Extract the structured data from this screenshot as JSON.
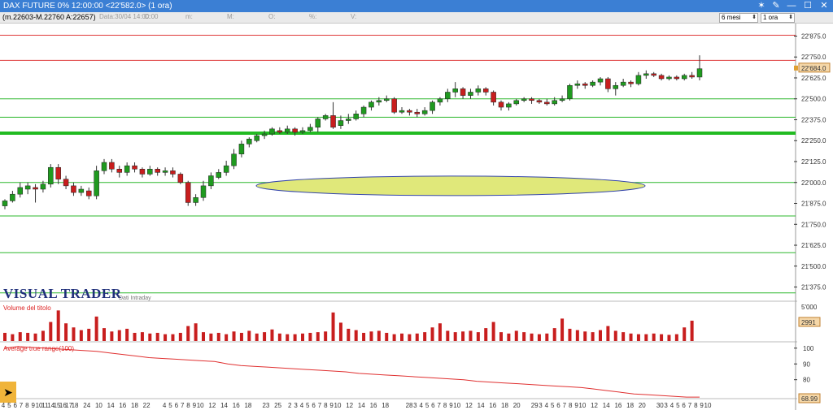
{
  "window": {
    "title": "DAX FUTURE 0%  12:00:00   <22'582.0>  (1 ora)",
    "controls": [
      "✶",
      "✎",
      "—",
      "☐",
      "✕"
    ]
  },
  "infobar": {
    "ohlc": "(m.22603-M.22760 A:22657)",
    "date_label": "Data:30/04 14:00:00",
    "dropdowns": [
      "C:",
      "m:",
      "M:",
      "O:",
      "%:",
      "V:"
    ],
    "period_select": "6 mesi",
    "interval_select": "1 ora"
  },
  "branding": {
    "logo": "VISUAL TRADER",
    "sub": "Dati Intraday"
  },
  "panels": {
    "volume_title": "Volume del titolo",
    "atr_title": "Average true range(100)"
  },
  "price_axis": {
    "ticks": [
      "22'875.0",
      "22'750.0",
      "22'625.0",
      "22'500.0",
      "22'375.0",
      "22'250.0",
      "22'125.0",
      "22'000.0",
      "21'875.0",
      "21'750.0",
      "21'625.0",
      "21'500.0",
      "21'375.0"
    ],
    "current": "22'684.0"
  },
  "volume_axis": {
    "tick": "5'000",
    "current": "2991"
  },
  "atr_axis": {
    "ticks": [
      "100",
      "90",
      "80"
    ],
    "current": "68.99"
  },
  "time_axis": {
    "labels": [
      "4",
      "5",
      "6",
      "7",
      "8",
      "9",
      "10",
      "11",
      "14",
      "15",
      "16",
      "17",
      "18",
      "",
      "24",
      "",
      "10",
      "",
      "14",
      "",
      "16",
      "",
      "18",
      "",
      "22",
      "",
      "",
      "4",
      "5",
      "6",
      "7",
      "8",
      "9",
      "10",
      "",
      "12",
      "",
      "14",
      "",
      "16",
      "",
      "18",
      "",
      "",
      "23",
      "",
      "25",
      "",
      "2",
      "3",
      "4",
      "5",
      "6",
      "7",
      "8",
      "9",
      "10",
      "",
      "12",
      "",
      "14",
      "",
      "16",
      "",
      "18",
      "",
      "",
      "",
      "28",
      "3",
      "4",
      "5",
      "6",
      "7",
      "8",
      "9",
      "10",
      "",
      "12",
      "",
      "14",
      "",
      "16",
      "",
      "18",
      "",
      "20",
      "",
      "",
      "29",
      "3",
      "4",
      "5",
      "6",
      "7",
      "8",
      "9",
      "10",
      "",
      "12",
      "",
      "14",
      "",
      "16",
      "",
      "18",
      "",
      "20",
      "",
      "",
      "30",
      "3",
      "4",
      "5",
      "6",
      "7",
      "8",
      "9",
      "10"
    ],
    "highlight": [
      "24",
      "25",
      "28",
      "29",
      "30"
    ]
  },
  "chart_data": {
    "type": "candlestick",
    "y_range": [
      21300,
      22950
    ],
    "horizontal_lines": {
      "red": [
        22880,
        22730
      ],
      "green": [
        22500,
        22390,
        22300,
        22000,
        21800,
        21580,
        21340
      ],
      "bold_green": 22295
    },
    "candles": [
      [
        21860,
        21890,
        21840,
        21900
      ],
      [
        21890,
        21930,
        21880,
        21950
      ],
      [
        21930,
        21970,
        21910,
        22000
      ],
      [
        21960,
        21980,
        21930,
        22000
      ],
      [
        21970,
        21960,
        21880,
        21990
      ],
      [
        21960,
        21990,
        21940,
        22010
      ],
      [
        21990,
        22090,
        21970,
        22110
      ],
      [
        22090,
        22020,
        21990,
        22110
      ],
      [
        22020,
        21980,
        21960,
        22040
      ],
      [
        21980,
        21940,
        21920,
        22000
      ],
      [
        21940,
        21960,
        21920,
        21980
      ],
      [
        21950,
        21920,
        21900,
        21970
      ],
      [
        21920,
        22070,
        21900,
        22100
      ],
      [
        22070,
        22120,
        22050,
        22140
      ],
      [
        22120,
        22080,
        22060,
        22140
      ],
      [
        22080,
        22060,
        22030,
        22100
      ],
      [
        22060,
        22100,
        22040,
        22120
      ],
      [
        22100,
        22080,
        22060,
        22120
      ],
      [
        22080,
        22050,
        22030,
        22090
      ],
      [
        22050,
        22080,
        22040,
        22100
      ],
      [
        22080,
        22060,
        22040,
        22090
      ],
      [
        22060,
        22070,
        22040,
        22090
      ],
      [
        22070,
        22050,
        22030,
        22090
      ],
      [
        22050,
        22000,
        21990,
        22060
      ],
      [
        22000,
        21880,
        21860,
        22010
      ],
      [
        21880,
        21910,
        21860,
        21930
      ],
      [
        21910,
        21980,
        21890,
        22010
      ],
      [
        21980,
        22040,
        21960,
        22060
      ],
      [
        22030,
        22060,
        22020,
        22080
      ],
      [
        22060,
        22100,
        22040,
        22130
      ],
      [
        22100,
        22170,
        22080,
        22200
      ],
      [
        22170,
        22230,
        22150,
        22250
      ],
      [
        22230,
        22260,
        22210,
        22270
      ],
      [
        22250,
        22280,
        22240,
        22290
      ],
      [
        22280,
        22290,
        22260,
        22310
      ],
      [
        22290,
        22320,
        22280,
        22330
      ],
      [
        22310,
        22300,
        22290,
        22330
      ],
      [
        22300,
        22320,
        22290,
        22340
      ],
      [
        22320,
        22300,
        22280,
        22330
      ],
      [
        22300,
        22310,
        22290,
        22330
      ],
      [
        22310,
        22330,
        22300,
        22350
      ],
      [
        22330,
        22380,
        22300,
        22390
      ],
      [
        22380,
        22400,
        22370,
        22410
      ],
      [
        22400,
        22330,
        22320,
        22480
      ],
      [
        22340,
        22370,
        22320,
        22400
      ],
      [
        22370,
        22380,
        22350,
        22410
      ],
      [
        22380,
        22410,
        22370,
        22430
      ],
      [
        22410,
        22450,
        22390,
        22460
      ],
      [
        22450,
        22480,
        22430,
        22490
      ],
      [
        22480,
        22490,
        22460,
        22510
      ],
      [
        22490,
        22500,
        22480,
        22520
      ],
      [
        22500,
        22420,
        22410,
        22510
      ],
      [
        22420,
        22430,
        22410,
        22450
      ],
      [
        22430,
        22420,
        22400,
        22440
      ],
      [
        22420,
        22410,
        22390,
        22440
      ],
      [
        22410,
        22430,
        22400,
        22450
      ],
      [
        22430,
        22480,
        22410,
        22490
      ],
      [
        22480,
        22500,
        22460,
        22510
      ],
      [
        22500,
        22540,
        22480,
        22560
      ],
      [
        22540,
        22560,
        22510,
        22600
      ],
      [
        22560,
        22520,
        22500,
        22570
      ],
      [
        22520,
        22540,
        22500,
        22560
      ],
      [
        22540,
        22560,
        22520,
        22580
      ],
      [
        22560,
        22540,
        22520,
        22570
      ],
      [
        22540,
        22480,
        22460,
        22550
      ],
      [
        22480,
        22450,
        22430,
        22490
      ],
      [
        22450,
        22470,
        22430,
        22480
      ],
      [
        22470,
        22490,
        22460,
        22500
      ],
      [
        22490,
        22500,
        22480,
        22510
      ],
      [
        22500,
        22490,
        22470,
        22510
      ],
      [
        22490,
        22480,
        22470,
        22500
      ],
      [
        22480,
        22470,
        22460,
        22500
      ],
      [
        22470,
        22490,
        22460,
        22510
      ],
      [
        22490,
        22500,
        22480,
        22520
      ],
      [
        22500,
        22580,
        22490,
        22590
      ],
      [
        22580,
        22590,
        22560,
        22610
      ],
      [
        22590,
        22580,
        22560,
        22600
      ],
      [
        22580,
        22600,
        22570,
        22610
      ],
      [
        22600,
        22620,
        22580,
        22630
      ],
      [
        22620,
        22560,
        22540,
        22630
      ],
      [
        22560,
        22580,
        22520,
        22600
      ],
      [
        22580,
        22600,
        22570,
        22620
      ],
      [
        22600,
        22590,
        22570,
        22610
      ],
      [
        22590,
        22640,
        22580,
        22660
      ],
      [
        22640,
        22650,
        22620,
        22670
      ],
      [
        22650,
        22640,
        22630,
        22660
      ],
      [
        22640,
        22620,
        22610,
        22650
      ],
      [
        22620,
        22630,
        22610,
        22640
      ],
      [
        22630,
        22620,
        22610,
        22640
      ],
      [
        22620,
        22640,
        22610,
        22650
      ],
      [
        22640,
        22630,
        22620,
        22660
      ],
      [
        22630,
        22680,
        22610,
        22760
      ]
    ],
    "volumes": [
      1200,
      1000,
      1300,
      1200,
      1100,
      1500,
      2800,
      4500,
      2600,
      2000,
      1600,
      1800,
      3600,
      1900,
      1400,
      1600,
      1800,
      1200,
      1300,
      1100,
      1200,
      1000,
      1000,
      1200,
      2200,
      2600,
      1300,
      1100,
      1200,
      1000,
      1400,
      1200,
      1500,
      1100,
      1300,
      1700,
      1100,
      1000,
      1000,
      1100,
      1200,
      1300,
      1400,
      4200,
      2700,
      1800,
      1600,
      1200,
      1400,
      1500,
      1200,
      1000,
      1100,
      1000,
      1100,
      1300,
      2000,
      2600,
      1500,
      1300,
      1400,
      1500,
      1300,
      1900,
      2800,
      1300,
      1100,
      1500,
      1300,
      1100,
      1000,
      1100,
      1900,
      3300,
      1800,
      1600,
      1400,
      1300,
      1600,
      2200,
      1500,
      1300,
      1100,
      1000,
      1000,
      1100,
      1000,
      900,
      1000,
      2000,
      2991
    ],
    "volume_max": 5500,
    "atr": [
      100,
      101,
      100.5,
      100,
      99.5,
      99,
      98.5,
      98,
      97,
      96,
      95,
      94,
      93.5,
      93,
      92.5,
      92,
      91.5,
      90,
      89,
      88.5,
      88,
      87.5,
      87,
      86.5,
      86,
      85.5,
      85,
      84,
      83.5,
      83,
      82.5,
      82,
      81.5,
      81,
      80.5,
      80,
      79,
      78.5,
      78,
      77.5,
      77,
      76.5,
      76,
      75.5,
      75,
      74,
      73,
      72,
      71,
      70.5,
      70,
      69.5,
      69,
      68.99
    ],
    "atr_range": [
      68,
      103
    ],
    "ellipse": {
      "center_price": 21980,
      "center_index_frac": 0.62,
      "note": ""
    }
  }
}
